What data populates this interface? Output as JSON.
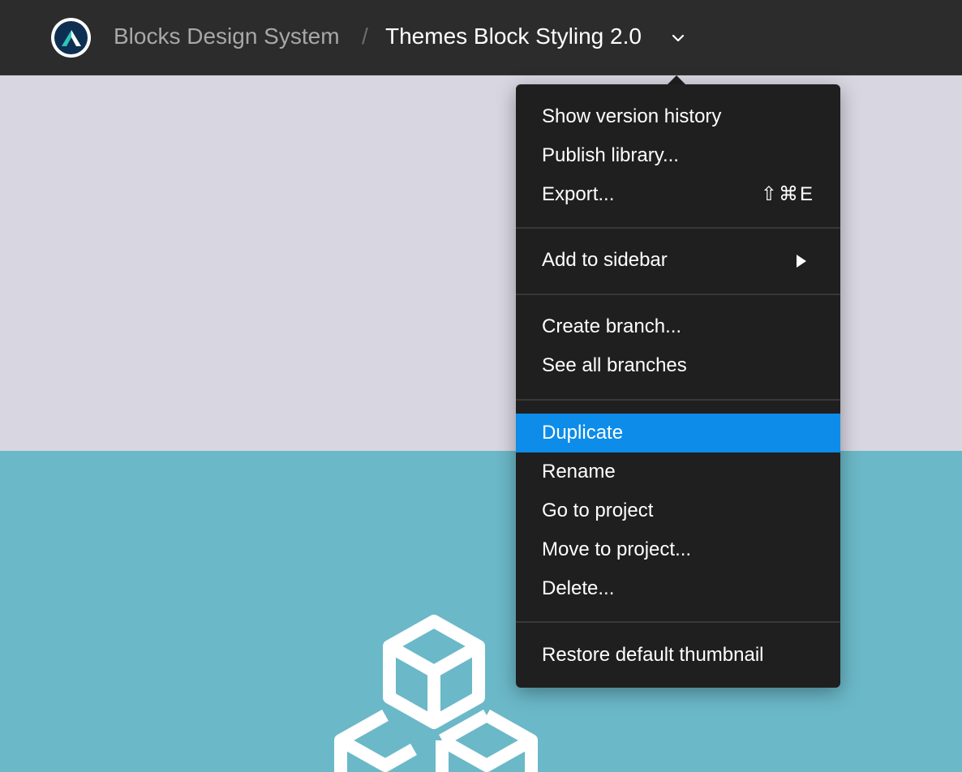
{
  "header": {
    "team_name": "Blocks Design System",
    "separator": "/",
    "file_title": "Themes Block Styling 2.0",
    "logo_icon": "blocks-logo-icon",
    "chevron_icon": "chevron-down-icon"
  },
  "menu": {
    "group1": [
      {
        "label": "Show version history"
      },
      {
        "label": "Publish library..."
      },
      {
        "label": "Export...",
        "shortcut": "⇧⌘E"
      }
    ],
    "group2": [
      {
        "label": "Add to sidebar",
        "submenu_icon": "triangle-right-icon"
      }
    ],
    "group3": [
      {
        "label": "Create branch..."
      },
      {
        "label": "See all branches"
      }
    ],
    "group4": [
      {
        "label": "Duplicate",
        "highlighted": true
      },
      {
        "label": "Rename"
      },
      {
        "label": "Go to project"
      },
      {
        "label": "Move to project..."
      },
      {
        "label": "Delete..."
      }
    ],
    "group5": [
      {
        "label": "Restore default thumbnail"
      }
    ]
  },
  "canvas": {
    "top_color": "#d8d6e0",
    "bottom_color": "#6bb8c8",
    "illustration_icon": "cubes-icon"
  },
  "colors": {
    "topbar": "#2c2c2c",
    "menu_bg": "#1f1f1f",
    "highlight": "#0d8ce9"
  }
}
